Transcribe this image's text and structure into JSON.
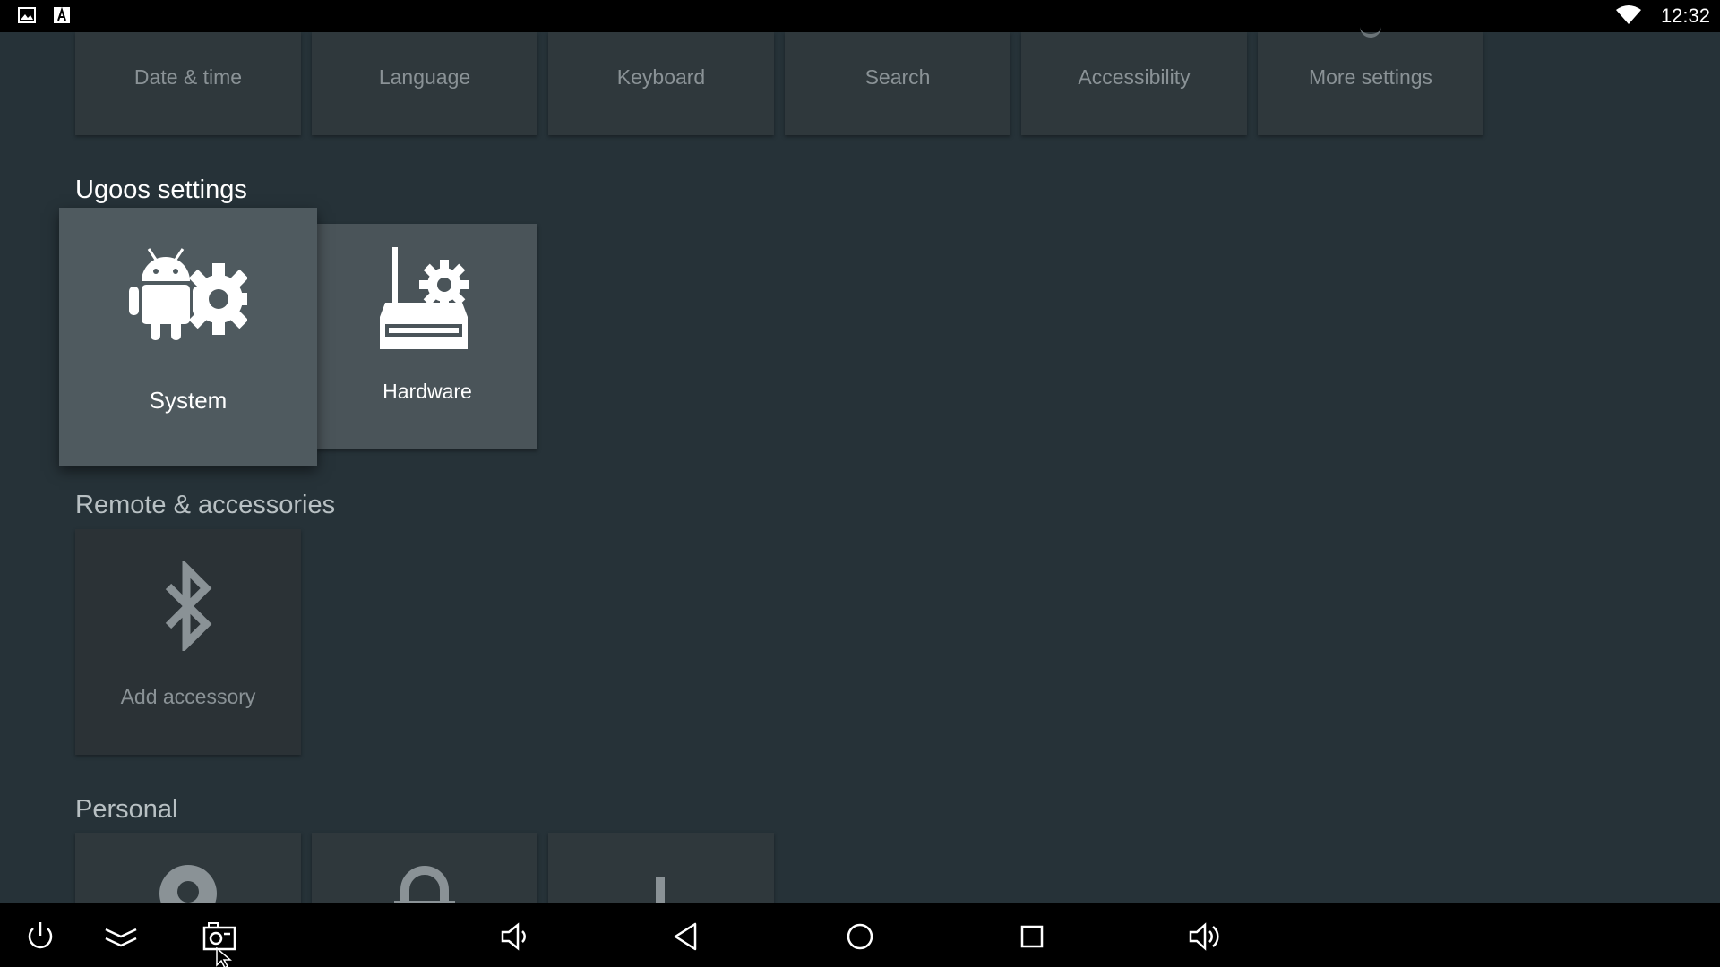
{
  "status_bar": {
    "time": "12:32",
    "left_icons": [
      "image-icon",
      "text-a-icon"
    ],
    "right_icons": [
      "wifi-icon"
    ]
  },
  "top_row": {
    "tiles": [
      {
        "label": "Date & time"
      },
      {
        "label": "Language"
      },
      {
        "label": "Keyboard"
      },
      {
        "label": "Search"
      },
      {
        "label": "Accessibility"
      },
      {
        "label": "More settings"
      }
    ]
  },
  "ugoos": {
    "title": "Ugoos settings",
    "tiles": [
      {
        "label": "System",
        "icon": "android-gear-icon",
        "focused": true
      },
      {
        "label": "Hardware",
        "icon": "router-gear-icon"
      }
    ]
  },
  "remote": {
    "title": "Remote & accessories",
    "tiles": [
      {
        "label": "Add accessory",
        "icon": "bluetooth-icon"
      }
    ]
  },
  "personal": {
    "title": "Personal",
    "tiles": [
      {
        "icon": "location-icon"
      },
      {
        "icon": "lock-icon"
      },
      {
        "icon": "info-icon"
      }
    ]
  },
  "nav_bar": {
    "buttons": [
      "power-icon",
      "collapse-icon",
      "screenshot-icon",
      "volume-down-icon",
      "back-icon",
      "home-icon",
      "recents-icon",
      "volume-up-icon"
    ]
  },
  "colors": {
    "background": "#263238",
    "tile": "#2f383c",
    "tile_focused": "#4f5a5f",
    "bar": "#000000"
  }
}
